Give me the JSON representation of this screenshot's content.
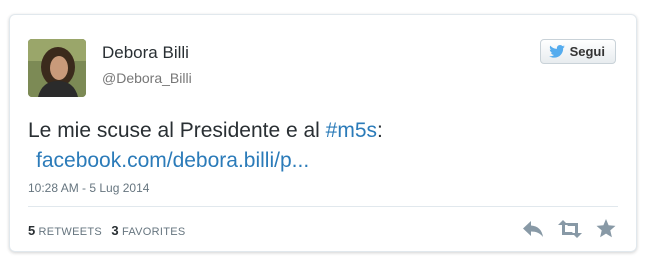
{
  "tweet": {
    "author_name": "Debora Billi",
    "author_handle": "@Debora_Billi",
    "follow_label": "Segui",
    "text_prefix": "Le mie scuse al Presidente e al ",
    "hashtag": "#m5s",
    "text_suffix": ":",
    "link": "facebook.com/debora.billi/p...",
    "timestamp": "10:28 AM - 5 Lug 2014",
    "retweets_count": "5",
    "retweets_label": "RETWEETS",
    "favorites_count": "3",
    "favorites_label": "FAVORITES"
  },
  "icons": {
    "follow": "twitter-bird-icon",
    "reply": "reply-icon",
    "retweet": "retweet-icon",
    "favorite": "star-icon"
  },
  "colors": {
    "link": "#2b7bb9",
    "icon": "#8899a6",
    "bird": "#55acee"
  }
}
